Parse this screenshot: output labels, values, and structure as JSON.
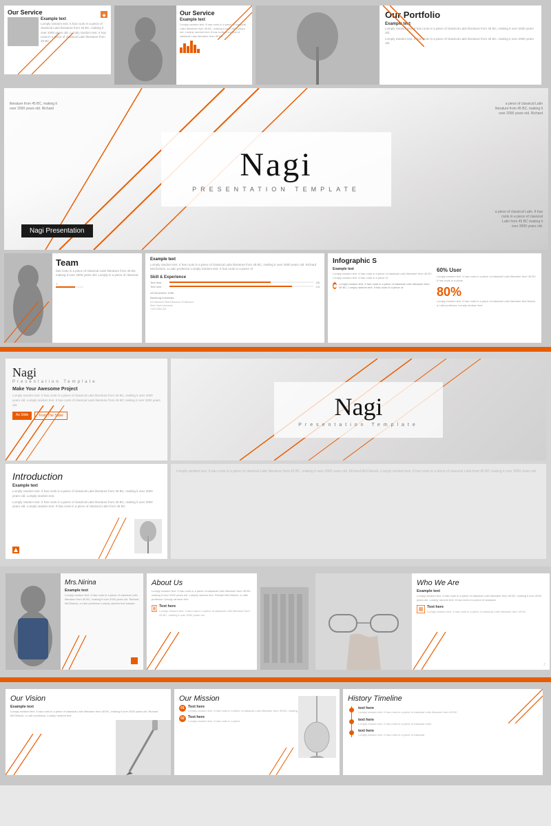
{
  "presentation": {
    "name": "Nagi",
    "subtitle": "Presentation Template",
    "presenter_name": "Nagi Presentation"
  },
  "row1": {
    "slide1": {
      "title": "Our Service",
      "example_label": "Example text",
      "body": "Lomply random text. It has roots in a piece of classical Latin literature from 45 BC, making it over 2000 years old. Lomply random text. It has roots in a piece of classical Latin literature from 45 BC."
    },
    "slide2": {
      "title": "Our Service",
      "example_label": "Example text",
      "body": "Lomply random text. It has roots in a piece of classical Latin literature from 45 BC, making it over 2000 years old. Lomply random text. It has roots in a piece of classical Latin literature from 45 BC."
    },
    "slide3": {
      "title": "Our Portfolio",
      "example_label": "Example text",
      "body": "Lomply random text. It has roots in a piece of classical Latin literature from 45 BC, making it over 2000 years old."
    }
  },
  "hero": {
    "title": "Nagi",
    "subtitle": "Presentation Template"
  },
  "row2": {
    "slide_team": {
      "title": "Team",
      "body": "has roots in a piece of classical Latin literature from 45 BC, making it over 2000 years old. Lomply in a piece of classical"
    },
    "slide_example": {
      "label": "Example text",
      "body": "Lomply random text. It has roots in a piece of classical Latin literature from 45 BC, making it over 2000 years old. Richard McClistock, a Latin professor Lomply random text. It has roots in a piece of"
    },
    "slide_infographic": {
      "title": "Infographic S",
      "label": "Example text",
      "body": "Lomply random text. It has roots in a piece of classical Latin literature from 45 BC. Lomply random text. It has roots in a piece of",
      "percent": "80%",
      "percent2": "60% User",
      "skill_label": "Skill & Experience"
    }
  },
  "section2": {
    "nagi_small": {
      "title": "Nagi",
      "subtitle": "Presentation Template",
      "tagline": "Make Your Awesome Project",
      "body": "Lomply random text. It has roots in a piece of classical Latin literature from 45 BC, making it over 2000 years old. Lomply random text. It has roots of classical Latin literature from 45 BC making it over 2000 years old.",
      "btn1": "As Slide",
      "btn2": "From The Slider"
    },
    "nagi_wide": {
      "title": "Nagi",
      "subtitle": "Presentation Template"
    },
    "intro": {
      "title": "Introduction",
      "example_label": "Example text",
      "body": "Lomply random text. It has roots in a piece of classical Latin literature from 45 BC, making it over 2000 years old. Lomply random text."
    }
  },
  "section3": {
    "nirina": {
      "name": "Mrs.Nirina",
      "example_label": "Example text",
      "body": "Lomply random text. It has roots in a piece of classical Latin literature from 45 BC, making it over 2000 years old. Richard McClistock, a Latin professor Lomply random text sample."
    },
    "about": {
      "title": "About Us",
      "body": "Lomply random text. It has roots in a piece of classical Latin literature from 45 BC, making it over 2000 years old. Lomply random text. Richard McClistock, a Latin professor Lomply random text.",
      "text_here": "Text here",
      "text_body": "Lomply random text. It has roots in a piece of classical Latin literature from 45 BC, making it over 2000 years old."
    },
    "who": {
      "title": "Who We Are",
      "example_label": "Example text",
      "body": "Lomply random text. It has roots in a piece of classical Latin literature from 45 BC, making it over 2000 years old. Lomply random text. It has roots in a piece of classical.",
      "text_here": "Text here",
      "text_body": "Lomply random text. It has roots in a piece of classical Latin literature from 45 BC."
    }
  },
  "section4": {
    "vision": {
      "title": "Our Vision",
      "example_label": "Example text",
      "body": "Lomply random text. It has roots in a piece of classical Latin literature from 45 BC, making it over 2000 years old. Richard McClistock, a Latin professor, Lomply random text."
    },
    "mission": {
      "title": "Our Mission",
      "text_here": "Text here",
      "body": "Lomply random text. It has roots in a piece of classical Latin literature from 45 BC, making it over 2000 years old."
    },
    "history": {
      "title": "History Timeline",
      "text_here": "text here",
      "body": "Lomply random text. It has roots in a piece of classical Latin literature from 45 BC."
    }
  },
  "colors": {
    "orange": "#e85c00",
    "dark": "#1a1a1a",
    "light_gray": "#f5f5f5",
    "mid_gray": "#888",
    "bg": "#d0d0d0"
  }
}
